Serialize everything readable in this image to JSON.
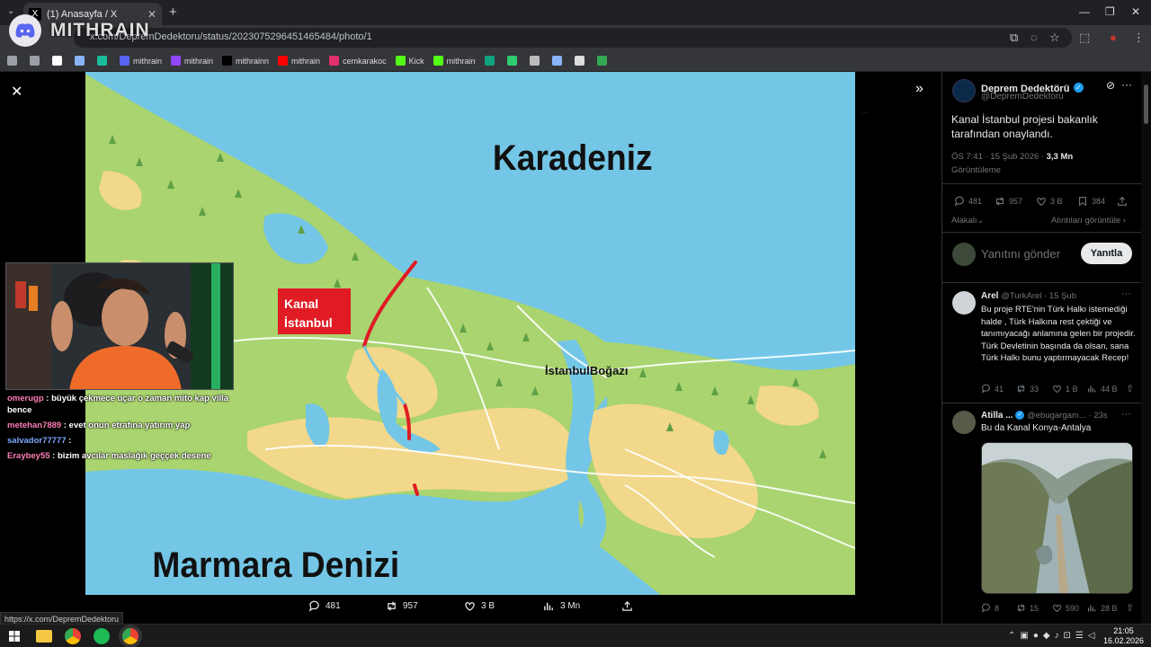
{
  "browser": {
    "tab_title": "(1) Anasayfa / X",
    "url": "x.com/DepremDedektoru/status/2023075296451465484/photo/1",
    "bookmarks": [
      {
        "label": "",
        "icon": "folder-icon",
        "color": "#9aa0a6"
      },
      {
        "label": "",
        "icon": "folder-icon",
        "color": "#9aa0a6"
      },
      {
        "label": "",
        "icon": "diamond-icon",
        "color": "#fff"
      },
      {
        "label": "",
        "icon": "swirl-icon",
        "color": "#8ab4f8"
      },
      {
        "label": "",
        "icon": "square-icon",
        "color": "#1abc9c"
      },
      {
        "label": "mithrain",
        "icon": "discord-icon",
        "color": "#5865f2"
      },
      {
        "label": "mithrain",
        "icon": "twitch-icon",
        "color": "#9146ff"
      },
      {
        "label": "mithrainn",
        "icon": "x-icon",
        "color": "#000000"
      },
      {
        "label": "mithrain",
        "icon": "youtube-icon",
        "color": "#ff0000"
      },
      {
        "label": "cemkarakoc",
        "icon": "instagram-icon",
        "color": "#e1306c"
      },
      {
        "label": "Kick",
        "icon": "kick-icon",
        "color": "#53fc18"
      },
      {
        "label": "mithrain",
        "icon": "kick-icon",
        "color": "#53fc18"
      },
      {
        "label": "",
        "icon": "chatgpt-icon",
        "color": "#10a37f"
      },
      {
        "label": "",
        "icon": "png-icon",
        "color": "#2ecc71"
      },
      {
        "label": "",
        "icon": "circle-icon",
        "color": "#bbb"
      },
      {
        "label": "",
        "icon": "sparkle-icon",
        "color": "#8ab4f8"
      },
      {
        "label": "",
        "icon": "image-icon",
        "color": "#ddd"
      },
      {
        "label": "",
        "icon": "maps-icon",
        "color": "#34a853"
      }
    ],
    "status_url": "https://x.com/DepremDedektoru"
  },
  "overlay": {
    "brand": "MITHRAIN",
    "chat": [
      {
        "user": "omerugp",
        "color": "#ff7eb6",
        "text": "büyük çekmece uçar o zaman mito kap villa bence"
      },
      {
        "user": "metehan7889",
        "color": "#ff7eb6",
        "text": "evet onun etrafına yatırım yap"
      },
      {
        "user": "salvador77777",
        "color": "#7ea8ff",
        "text": ""
      },
      {
        "user": "Eraybey55",
        "color": "#ff7eb6",
        "text": "bizim avcılar maslağık geççek desene"
      }
    ]
  },
  "map": {
    "labels": {
      "sea_north": "Karadeniz",
      "sea_south": "Marmara Denizi",
      "canal": "Kanal İstanbul",
      "strait": "İstanbulBoğazı"
    },
    "colors": {
      "sea": "#74c6e6",
      "land_green": "#a9d46f",
      "land_yellow": "#f2d88a",
      "canal": "#e01b24"
    }
  },
  "photo_actions": {
    "replies": "481",
    "reposts": "957",
    "likes": "3 B",
    "views": "3 Mn"
  },
  "tweet": {
    "author": "Deprem Dedektörü",
    "handle": "@DepremDedektoru",
    "text": "Kanal İstanbul projesi bakanlık tarafından onaylandı.",
    "time": "ÖS 7:41 · 15 Şub 2026 ·",
    "views_count": "3,3 Mn",
    "views_label": "Görüntüleme",
    "stats": {
      "replies": "481",
      "reposts": "957",
      "likes": "3 B",
      "bookmarks": "384"
    },
    "relevant": "Alakalı",
    "quotes_link": "Alıntıları görüntüle",
    "reply_placeholder": "Yanıtını gönder",
    "reply_button": "Yanıtla"
  },
  "replies": [
    {
      "name": "Arel",
      "handle": "@TurkArel · 15 Şub",
      "text": "Bu proje RTE'nin Türk Halkı istemediği halde , Türk Halkına  rest çektiği ve tanımıyacağı anlamına gelen bir projedir. Türk Devletinin başında da olsan, sana Türk Halkı bunu yaptırmayacak Recep!",
      "stats": {
        "replies": "41",
        "reposts": "33",
        "likes": "1 B",
        "views": "44 B"
      }
    },
    {
      "name": "Atilla ...",
      "handle": "@ebugargam...",
      "time": "· 23s",
      "text": "Bu da Kanal Konya-Antalya",
      "stats": {
        "replies": "8",
        "reposts": "15",
        "likes": "590",
        "views": "28 B"
      }
    }
  ],
  "taskbar": {
    "time": "21:05",
    "date": "16.02.2026"
  }
}
